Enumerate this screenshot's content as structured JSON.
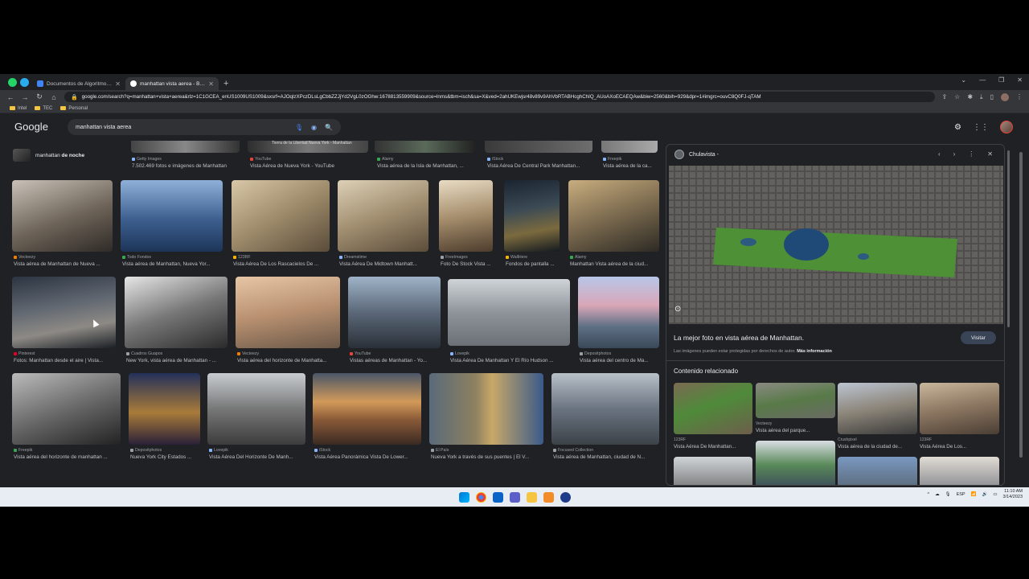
{
  "browser": {
    "tabs": [
      {
        "label": "Documentos de Algoritmos Y Es",
        "active": false
      },
      {
        "label": "manhattan vista aerea - Búsqu",
        "active": true
      }
    ],
    "url": "google.com/search?q=manhattan+vista+aerea&rlz=1C1GCEA_enUS1009US1009&sxsrf=AJOqlzXPczDLsLgCbbZZJjYd2VgL0zOGhw:1678813559909&source=lnms&tbm=isch&sa=X&ved=2ahUKEwjsr48v89v9AhVbRTABHcghChIQ_AUoAXoECAEQAw&biw=2560&bih=929&dpr=1#imgrc=ouvC8Q0FJ-qTAM",
    "bookmarks": [
      "Intel",
      "TEC",
      "Personal"
    ]
  },
  "google": {
    "logo": "Google",
    "query": "manhattan vista aerea"
  },
  "related_chip": {
    "prefix": "manhattan ",
    "bold": "de noche"
  },
  "row0": [
    {
      "source": "Getty Images",
      "title": "7.502.469 fotos e imágenes de Manhattan"
    },
    {
      "source": "YouTube",
      "title": "Vista Aérea de Nueva York - YouTube",
      "overlay": "Tierra de la Libertad Nueva York - Manhattan"
    },
    {
      "source": "Alamy",
      "title": "Vista aérea de la Isla de Manhattan, ..."
    },
    {
      "source": "iStock",
      "title": "Vista Aérea De Central Park Manhattan..."
    },
    {
      "source": "Freepik",
      "title": "Vista aérea de la ca..."
    }
  ],
  "row1": [
    {
      "source": "Vecteezy",
      "title": "Vista aérea de Manhattan de Nueva ..."
    },
    {
      "source": "Todo Fondos",
      "title": "Vista aérea de Manhattan, Nueva Yor..."
    },
    {
      "source": "123RF",
      "title": "Vista Aérea De Los Rascacielos De ..."
    },
    {
      "source": "Dreamstime",
      "title": "Vista Aérea De Midtown Manhatt..."
    },
    {
      "source": "FreeImages",
      "title": "Foto De Stock Vista ..."
    },
    {
      "source": "WallHere",
      "title": "Fondos de pantalla ..."
    },
    {
      "source": "Alamy",
      "title": "Manhattan Vista aérea de la ciud..."
    }
  ],
  "row2": [
    {
      "source": "Pinterest",
      "title": "Fotos: Manhattan desde el aire | Vista..."
    },
    {
      "source": "Cuadros Guapos",
      "title": "New York, vista aérea de Manhattan - ..."
    },
    {
      "source": "Vecteezy",
      "title": "Vista aérea del horizonte de Manhatta..."
    },
    {
      "source": "YouTube",
      "title": "Vistas aéreas de Manhattan - Yo..."
    },
    {
      "source": "Lovepik",
      "title": "Vista Aérea De Manhattan Y El Río Hudson ..."
    },
    {
      "source": "Depositphotos",
      "title": "Vista aérea del centro de Ma..."
    }
  ],
  "row3": [
    {
      "source": "Freepik",
      "title": "Vista aérea del horizonte de manhattan ..."
    },
    {
      "source": "Depositphotos",
      "title": "Nueva York City Estados ..."
    },
    {
      "source": "Lovepik",
      "title": "Vista Aérea Del Horizonte De Manh..."
    },
    {
      "source": "iStock",
      "title": "Vista Aérea Panorámica Vista De Lower..."
    },
    {
      "source": "El País",
      "title": "Nueva York a través de sus puentes | El V..."
    },
    {
      "source": "Focused Collection",
      "title": "Vista aérea de Manhattan, ciudad de N..."
    }
  ],
  "panel": {
    "site": "Chulavista -",
    "title": "La mejor foto en vista aérea de Manhattan.",
    "note": "Las imágenes pueden estar protegidas por derechos de autor.",
    "more": "Más información",
    "visit": "Visitar",
    "related_heading": "Contenido relacionado",
    "related": [
      {
        "source": "123RF",
        "title": "Vista Aérea De Manhattan..."
      },
      {
        "source": "Vecteezy",
        "title": "Vista aérea del parque..."
      },
      {
        "source": "Crushpixel",
        "title": "Vista aérea de la ciudad de..."
      },
      {
        "source": "123RF",
        "title": "Vista Aérea De Los..."
      }
    ]
  },
  "tray": {
    "lang": "ESP",
    "time": "11:10 AM",
    "date": "3/14/2023"
  }
}
